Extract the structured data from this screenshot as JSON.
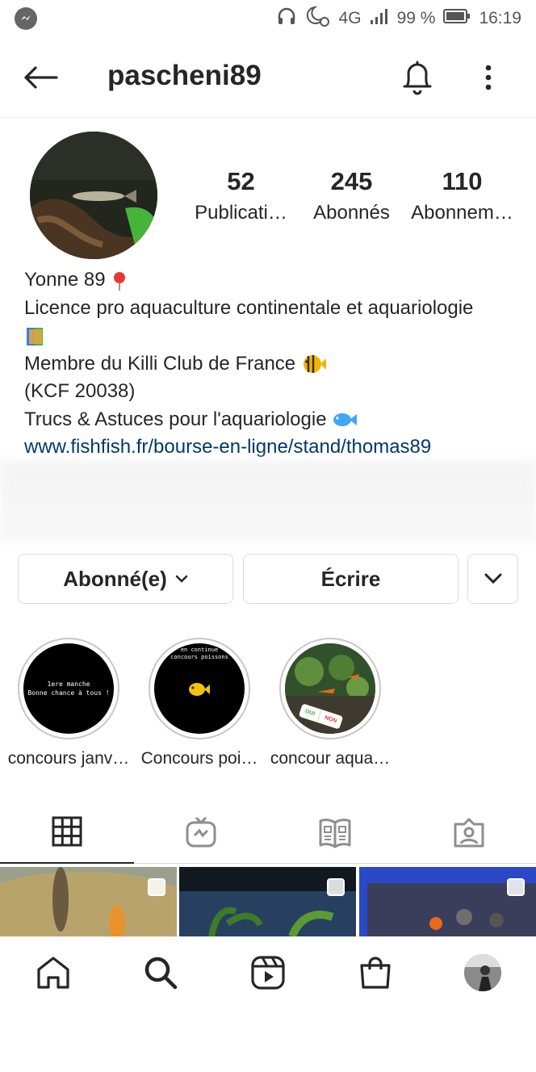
{
  "status_bar": {
    "network": "4G",
    "battery": "99 %",
    "time": "16:19"
  },
  "header": {
    "username": "pascheni89"
  },
  "profile": {
    "stats": [
      {
        "value": "52",
        "label": "Publicati…"
      },
      {
        "value": "245",
        "label": "Abonnés"
      },
      {
        "value": "110",
        "label": "Abonnem…"
      }
    ],
    "bio": {
      "line1": "Yonne 89",
      "line2": "Licence pro aquaculture continentale et aquariologie",
      "line3": "Membre du Killi Club de France",
      "line4": "(KCF 20038)",
      "line5": "Trucs & Astuces pour l'aquariologie",
      "link": "www.fishfish.fr/bourse-en-ligne/stand/thomas89"
    }
  },
  "actions": {
    "follow_label": "Abonné(e)",
    "write_label": "Écrire"
  },
  "highlights": [
    {
      "caption": "concours janv…",
      "inner_text_1": "1ere manche",
      "inner_text_2": "Bonne chance à tous !"
    },
    {
      "caption": "Concours poi…",
      "inner_text_1": "en continue",
      "inner_text_2": "concours poissons"
    },
    {
      "caption": "concour aqua…",
      "badge_yes": "OUI",
      "badge_no": "NON"
    }
  ],
  "tabs": [
    "grid-icon",
    "igtv-icon",
    "guide-icon",
    "tagged-icon"
  ],
  "bottom_nav": [
    "home-icon",
    "search-icon",
    "reels-icon",
    "shop-icon",
    "profile-avatar"
  ],
  "colors": {
    "link": "#00376b",
    "text": "#262626",
    "border": "#dbdbdb"
  }
}
